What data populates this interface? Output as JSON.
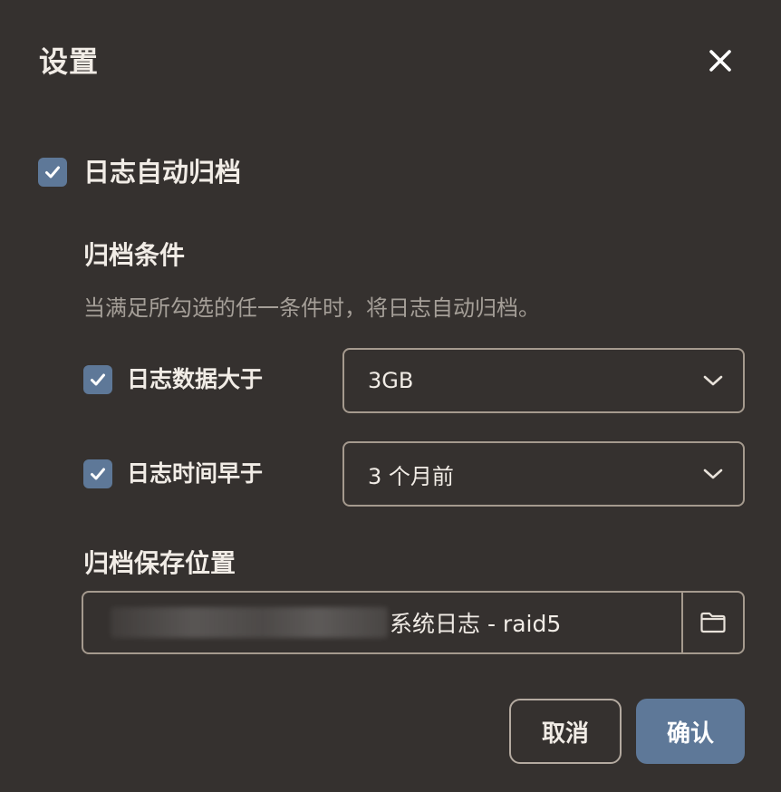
{
  "dialog": {
    "title": "设置",
    "close_icon": "close-icon"
  },
  "auto_archive": {
    "checked": true,
    "label": "日志自动归档"
  },
  "conditions": {
    "title": "归档条件",
    "description": "当满足所勾选的任一条件时，将日志自动归档。",
    "size": {
      "checked": true,
      "label": "日志数据大于",
      "selected": "3GB"
    },
    "age": {
      "checked": true,
      "label": "日志时间早于",
      "selected": "3 个月前"
    }
  },
  "location": {
    "title": "归档保存位置",
    "path_visible_suffix": "系统日志 - raid5",
    "browse_icon": "folder-icon"
  },
  "buttons": {
    "cancel": "取消",
    "confirm": "确认"
  },
  "colors": {
    "background": "#35312f",
    "accent": "#5e7898",
    "border": "#a59a8e",
    "muted_text": "#a59f98"
  }
}
